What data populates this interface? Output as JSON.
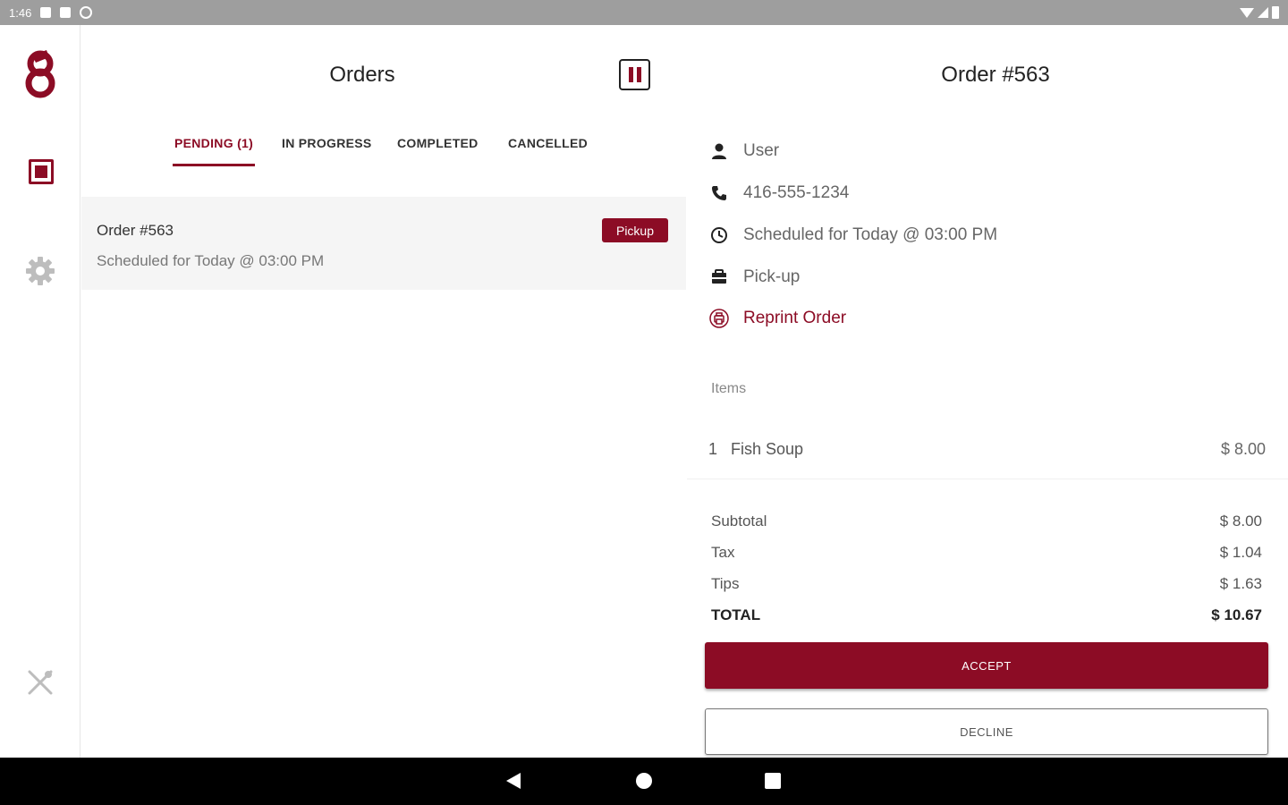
{
  "status_bar": {
    "time": "1:46"
  },
  "orders": {
    "title": "Orders",
    "tabs": [
      {
        "label": "PENDING (1)"
      },
      {
        "label": "IN PROGRESS"
      },
      {
        "label": "COMPLETED"
      },
      {
        "label": "CANCELLED"
      }
    ],
    "cards": [
      {
        "title": "Order #563",
        "subtitle": "Scheduled for Today @ 03:00 PM",
        "badge": "Pickup"
      }
    ]
  },
  "detail": {
    "title": "Order #563",
    "customer": "User",
    "phone": "416-555-1234",
    "schedule": "Scheduled for Today @ 03:00 PM",
    "method": "Pick-up",
    "reprint_label": "Reprint Order",
    "items_label": "Items",
    "items": [
      {
        "qty": "1",
        "name": "Fish Soup",
        "price": "$ 8.00"
      }
    ],
    "summary": {
      "subtotal_label": "Subtotal",
      "subtotal": "$ 8.00",
      "tax_label": "Tax",
      "tax": "$ 1.04",
      "tips_label": "Tips",
      "tips": "$ 1.63",
      "total_label": "TOTAL",
      "total": "$ 10.67"
    },
    "accept_label": "ACCEPT",
    "decline_label": "DECLINE"
  },
  "colors": {
    "accent": "#8c0c25",
    "status_bar": "#9e9e9e",
    "card_bg": "#f5f5f5"
  },
  "icons": [
    "logo-icon",
    "orders-icon",
    "gear-icon",
    "utensils-icon",
    "pause-icon",
    "person-icon",
    "phone-icon",
    "clock-icon",
    "bag-icon",
    "printer-icon"
  ]
}
